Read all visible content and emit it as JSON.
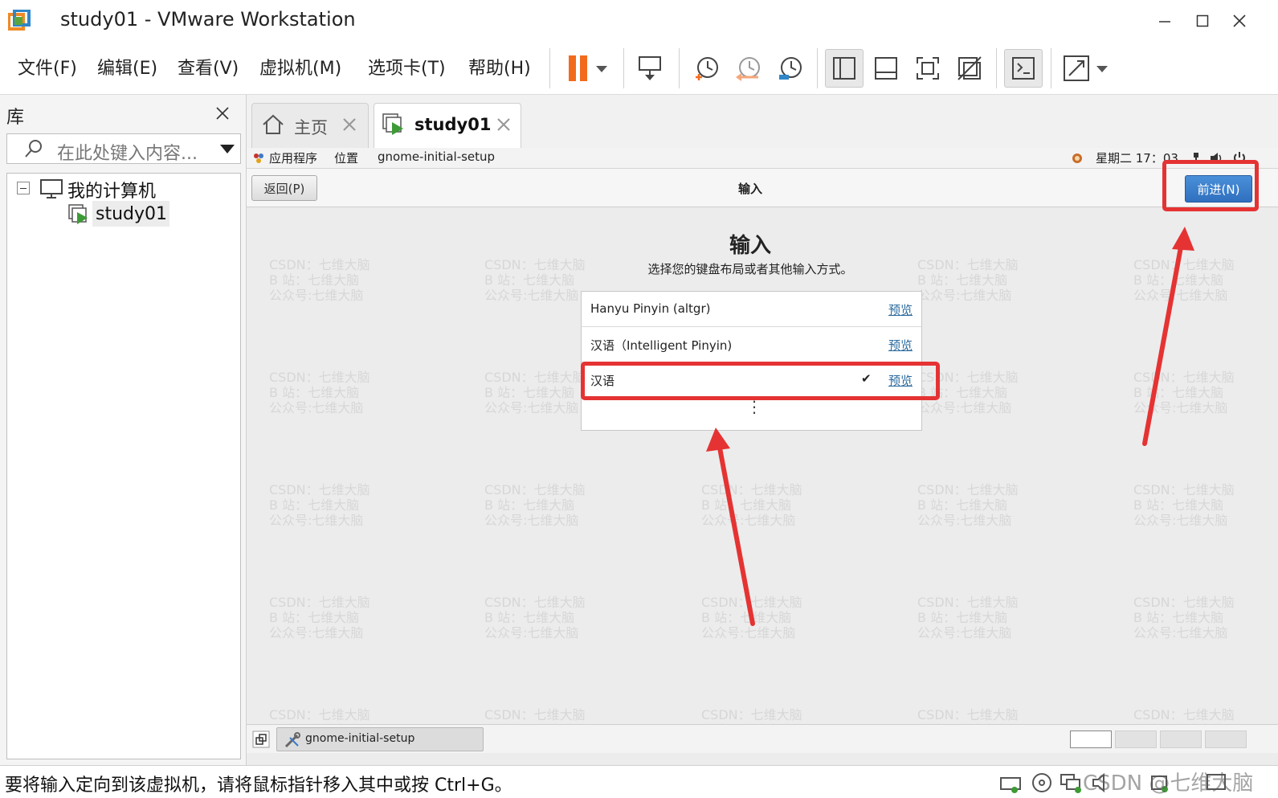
{
  "window": {
    "title": "study01 - VMware Workstation",
    "minimize_icon": "minimize-icon",
    "maximize_icon": "maximize-icon",
    "close_icon": "close-icon"
  },
  "menu": {
    "items": [
      "文件(F)",
      "编辑(E)",
      "查看(V)",
      "虚拟机(M)",
      "选项卡(T)",
      "帮助(H)"
    ]
  },
  "library": {
    "title": "库",
    "search_placeholder": "在此处键入内容...",
    "tree": {
      "root": "我的计算机",
      "child": "study01"
    }
  },
  "tabs": [
    {
      "label": "主页"
    },
    {
      "label": "study01"
    }
  ],
  "guest": {
    "topbar": {
      "apps": "应用程序",
      "places": "位置",
      "app_name": "gnome-initial-setup",
      "clock": "星期二 17：03"
    },
    "header": {
      "back": "返回(P)",
      "title": "输入",
      "next": "前进(N)"
    },
    "page": {
      "heading": "输入",
      "subtitle": "选择您的键盘布局或者其他输入方式。"
    },
    "inputs": [
      {
        "label": "Hanyu Pinyin (altgr)",
        "preview": "预览"
      },
      {
        "label": "汉语（Intelligent Pinyin)",
        "preview": "预览"
      },
      {
        "label": "汉语",
        "preview": "预览",
        "check": "✔"
      }
    ],
    "more": "⋮",
    "taskbar": {
      "item": "gnome-initial-setup"
    }
  },
  "watermark": {
    "line1": "CSDN：七维大脑",
    "line2": "B 站：七维大脑",
    "line3": "公众号:七维大脑"
  },
  "status": {
    "text": "要将输入定向到该虚拟机，请将鼠标指针移入其中或按 Ctrl+G。",
    "corner_watermark": "CSDN @七维大脑"
  },
  "colors": {
    "accent_blue": "#2f6fbf",
    "highlight_red": "#e53333",
    "pause_orange": "#f26b1d",
    "vm_green": "#3d9b35"
  }
}
